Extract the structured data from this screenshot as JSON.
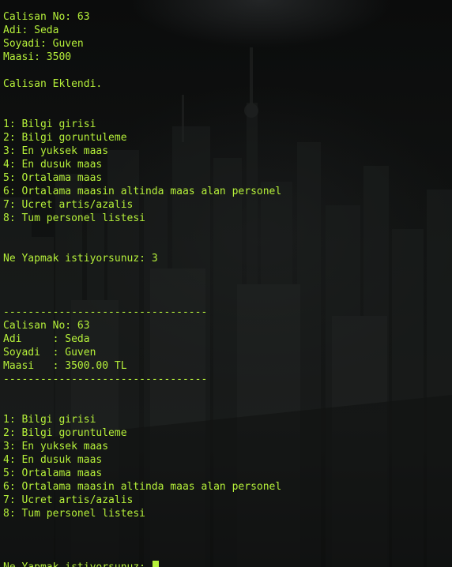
{
  "terminal": {
    "lines": [
      "Calisan No: 63",
      "Adi: Seda",
      "Soyadi: Guven",
      "Maasi: 3500",
      "",
      "Calisan Eklendi.",
      "",
      "",
      "1: Bilgi girisi",
      "2: Bilgi goruntuleme",
      "3: En yuksek maas",
      "4: En dusuk maas",
      "5: Ortalama maas",
      "6: Ortalama maasin altinda maas alan personel",
      "7: Ucret artis/azalis",
      "8: Tum personel listesi",
      "",
      "",
      "Ne Yapmak istiyorsunuz: 3",
      "",
      "",
      "",
      "---------------------------------",
      "Calisan No: 63",
      "Adi     : Seda",
      "Soyadi  : Guven",
      "Maasi   : 3500.00 TL",
      "---------------------------------",
      "",
      "",
      "1: Bilgi girisi",
      "2: Bilgi goruntuleme",
      "3: En yuksek maas",
      "4: En dusuk maas",
      "5: Ortalama maas",
      "6: Ortalama maasin altinda maas alan personel",
      "7: Ucret artis/azalis",
      "8: Tum personel listesi",
      "",
      "",
      "",
      "Ne Yapmak istiyorsunuz: "
    ],
    "colors": {
      "text": "#b6f13a",
      "background": "#0d0e0d",
      "cursor": "#b6f13a"
    }
  }
}
